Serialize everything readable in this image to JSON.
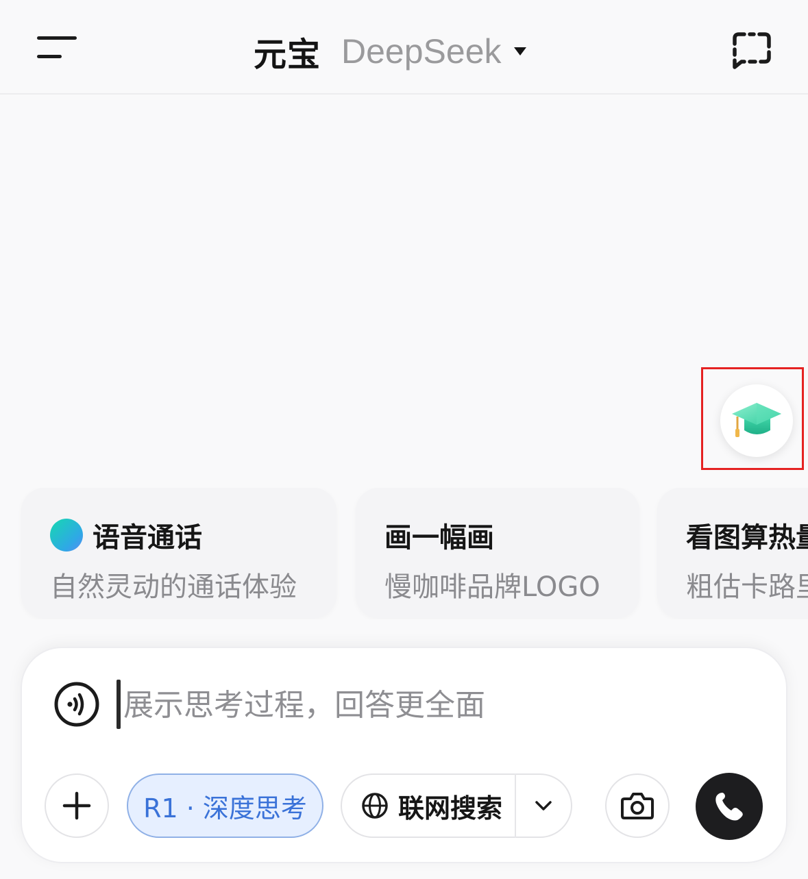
{
  "header": {
    "title_main": "元宝",
    "title_model": "DeepSeek"
  },
  "quick_cards": [
    {
      "title": "语音通话",
      "subtitle": "自然灵动的通话体验",
      "has_dot": true
    },
    {
      "title": "画一幅画",
      "subtitle": "慢咖啡品牌LOGO",
      "has_dot": false
    },
    {
      "title": "看图算热量",
      "subtitle": "粗估卡路里",
      "has_dot": false
    }
  ],
  "composer": {
    "placeholder": "展示思考过程，回答更全面",
    "r1_label": "R1 · 深度思考",
    "search_label": "联网搜索"
  },
  "icons": {
    "menu": "menu-icon",
    "new_chat": "new-chat-icon",
    "education": "graduation-cap-icon",
    "voice": "voice-wave-icon",
    "plus": "plus-icon",
    "globe": "globe-icon",
    "chevron": "chevron-down-icon",
    "camera": "camera-icon",
    "phone": "phone-icon"
  },
  "colors": {
    "accent_blue": "#3a72d8",
    "r1_pill_bg": "#e6efff",
    "highlight_red": "#e52222",
    "call_button": "#1d1d1f"
  }
}
